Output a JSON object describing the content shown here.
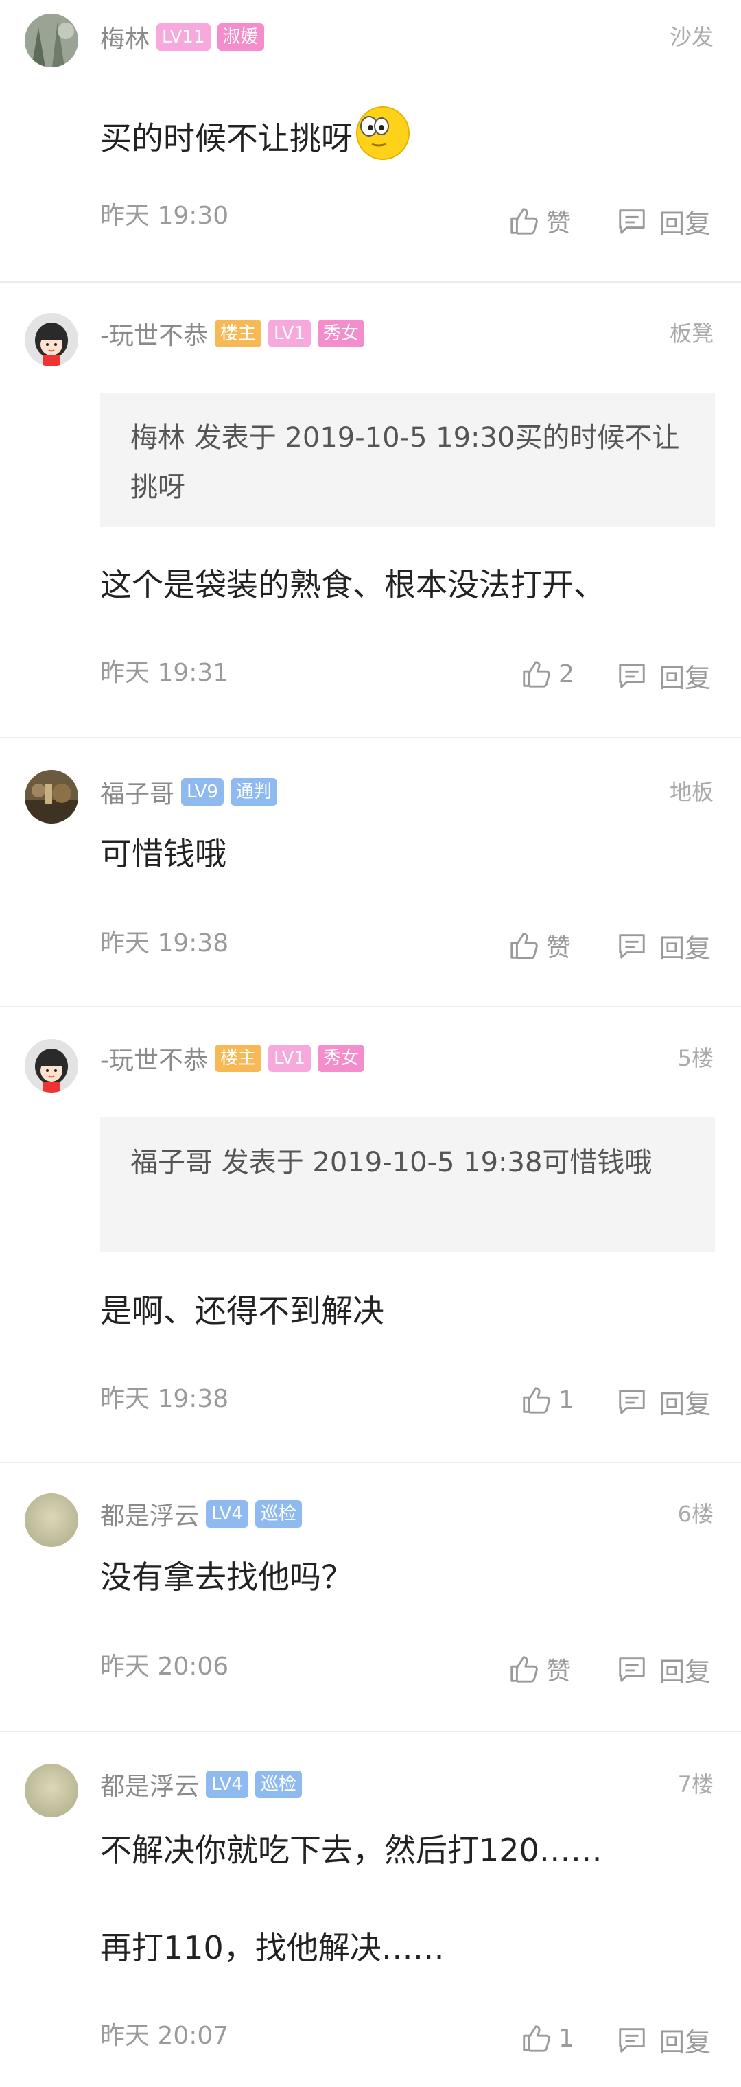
{
  "comments": [
    {
      "user": "梅林",
      "badges": [
        {
          "text": "LV11",
          "color": "#f7a8dd"
        },
        {
          "text": "淑媛",
          "color": "#f48dcc"
        }
      ],
      "floor": "沙发",
      "text": "买的时候不让挑呀",
      "has_emoji": true,
      "time": "昨天 19:30",
      "likes": "赞",
      "reply": "回复"
    },
    {
      "user": "-玩世不恭",
      "badges": [
        {
          "text": "楼主",
          "color": "#f7b955"
        },
        {
          "text": "LV1",
          "color": "#f7a8dd"
        },
        {
          "text": "秀女",
          "color": "#f48dcc"
        }
      ],
      "floor": "板凳",
      "quote": "梅林 发表于 2019-10-5 19:30买的时候不让挑呀",
      "text": "这个是袋装的熟食、根本没法打开、",
      "time": "昨天 19:31",
      "likes": "2",
      "reply": "回复"
    },
    {
      "user": "福子哥",
      "badges": [
        {
          "text": "LV9",
          "color": "#8fbaf0"
        },
        {
          "text": "通判",
          "color": "#8fbaf0"
        }
      ],
      "floor": "地板",
      "text": "可惜钱哦",
      "time": "昨天 19:38",
      "likes": "赞",
      "reply": "回复"
    },
    {
      "user": "-玩世不恭",
      "badges": [
        {
          "text": "楼主",
          "color": "#f7b955"
        },
        {
          "text": "LV1",
          "color": "#f7a8dd"
        },
        {
          "text": "秀女",
          "color": "#f48dcc"
        }
      ],
      "floor": "5楼",
      "quote": "福子哥 发表于 2019-10-5 19:38可惜钱哦",
      "text": "是啊、还得不到解决",
      "time": "昨天 19:38",
      "likes": "1",
      "reply": "回复"
    },
    {
      "user": "都是浮云",
      "badges": [
        {
          "text": "LV4",
          "color": "#8fbaf0"
        },
        {
          "text": "巡检",
          "color": "#8fbaf0"
        }
      ],
      "floor": "6楼",
      "text": "没有拿去找他吗？",
      "time": "昨天 20:06",
      "likes": "赞",
      "reply": "回复"
    },
    {
      "user": "都是浮云",
      "badges": [
        {
          "text": "LV4",
          "color": "#8fbaf0"
        },
        {
          "text": "巡检",
          "color": "#8fbaf0"
        }
      ],
      "floor": "7楼",
      "text": "不解决你就吃下去，然后打120……",
      "text2": "再打110，找他解决……",
      "time": "昨天 20:07",
      "likes": "1",
      "reply": "回复"
    }
  ],
  "avatars": [
    "photo-avatar",
    "cartoon-girl-avatar",
    "photo-avatar",
    "cartoon-girl-avatar",
    "plain-avatar",
    "plain-avatar"
  ]
}
